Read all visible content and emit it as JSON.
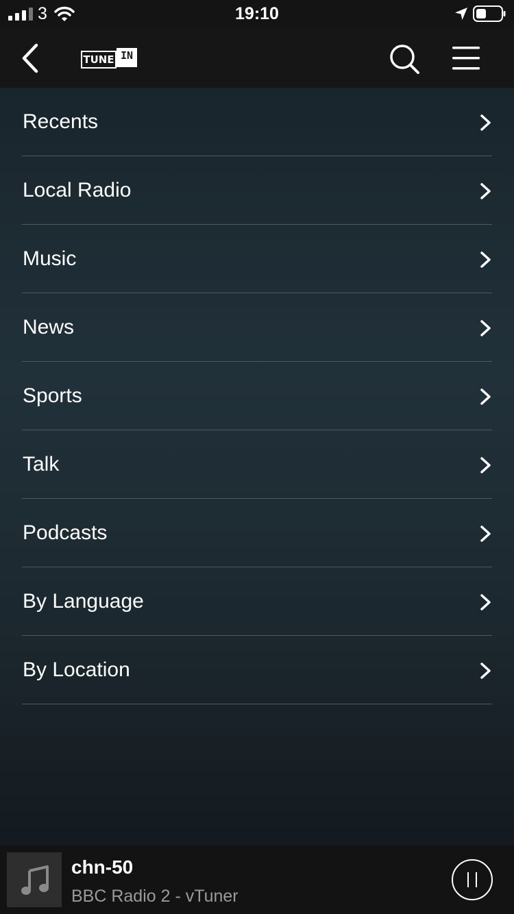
{
  "status_bar": {
    "carrier": "3",
    "time": "19:10",
    "icons": [
      "signal-icon",
      "wifi-icon",
      "location-icon",
      "battery-icon"
    ]
  },
  "nav": {
    "logo": {
      "part1": "TUNE",
      "part2": "IN"
    },
    "icons": [
      "back-chevron-icon",
      "search-icon",
      "hamburger-menu-icon"
    ]
  },
  "menu": {
    "items": [
      {
        "label": "Recents"
      },
      {
        "label": "Local Radio"
      },
      {
        "label": "Music"
      },
      {
        "label": "News"
      },
      {
        "label": "Sports"
      },
      {
        "label": "Talk"
      },
      {
        "label": "Podcasts"
      },
      {
        "label": "By Language"
      },
      {
        "label": "By Location"
      }
    ],
    "item_icon": "chevron-right-icon"
  },
  "now_playing": {
    "title": "chn-50",
    "subtitle": "BBC Radio 2 - vTuner",
    "artwork_icon": "music-note-icon",
    "control_icon": "pause-icon"
  },
  "colors": {
    "background_top": "#19252c",
    "background_bottom": "#141a1f",
    "bar": "#161616",
    "text": "#ffffff",
    "subtitle": "#9a9a9a",
    "divider": "#4d5a62"
  }
}
